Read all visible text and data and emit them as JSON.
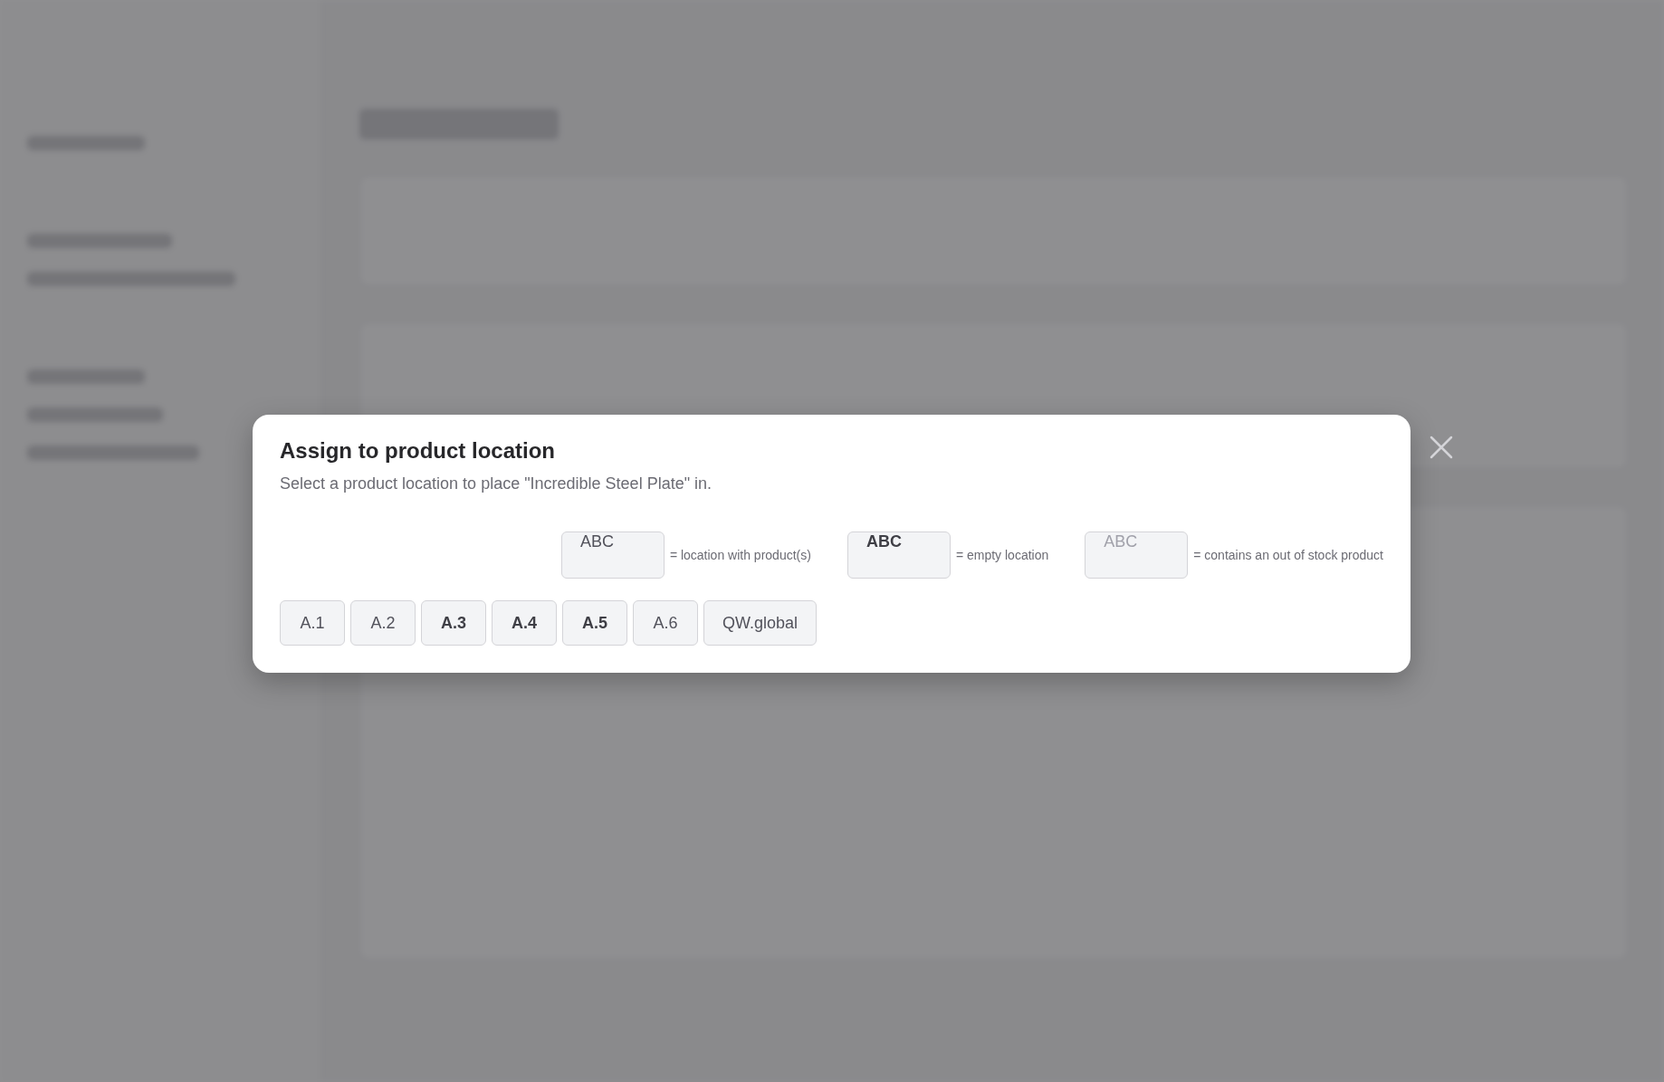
{
  "dialog": {
    "title": "Assign to product location",
    "description": "Select a product location to place \"Incredible Steel Plate\" in.",
    "legend": [
      {
        "kind": "filled",
        "sample": "ABC",
        "label": "= location with product(s)"
      },
      {
        "kind": "empty",
        "sample": "ABC",
        "label": "= empty location"
      },
      {
        "kind": "out_of_stock",
        "sample": "ABC",
        "label": "= contains an out of stock product"
      }
    ],
    "locations": [
      {
        "label": "A.1",
        "kind": "filled"
      },
      {
        "label": "A.2",
        "kind": "filled"
      },
      {
        "label": "A.3",
        "kind": "empty"
      },
      {
        "label": "A.4",
        "kind": "empty"
      },
      {
        "label": "A.5",
        "kind": "empty"
      },
      {
        "label": "A.6",
        "kind": "filled"
      },
      {
        "label": "QW.global",
        "kind": "filled"
      }
    ]
  }
}
